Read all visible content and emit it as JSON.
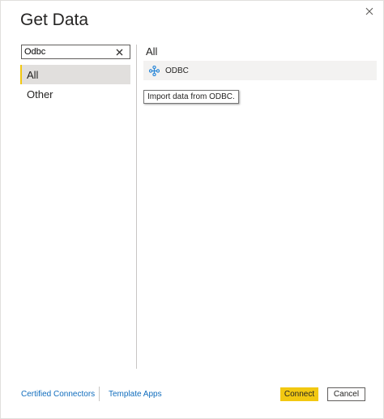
{
  "dialog": {
    "title": "Get Data",
    "close_icon": "close-icon"
  },
  "search": {
    "value": "Odbc",
    "placeholder": "",
    "clear_icon": "clear-icon"
  },
  "categories": [
    {
      "label": "All",
      "selected": true
    },
    {
      "label": "Other",
      "selected": false
    }
  ],
  "results": {
    "section_title": "All",
    "items": [
      {
        "label": "ODBC",
        "icon": "odbc-icon"
      }
    ],
    "tooltip": "Import data from ODBC."
  },
  "footer": {
    "certified_connectors": "Certified Connectors",
    "template_apps": "Template Apps",
    "connect_label": "Connect",
    "cancel_label": "Cancel"
  },
  "colors": {
    "accent": "#f2c811",
    "selected_bg": "#e1dfdd",
    "hover_bg": "#f3f2f1",
    "link": "#0f6cbd",
    "odbc_icon": "#2b88d8"
  }
}
